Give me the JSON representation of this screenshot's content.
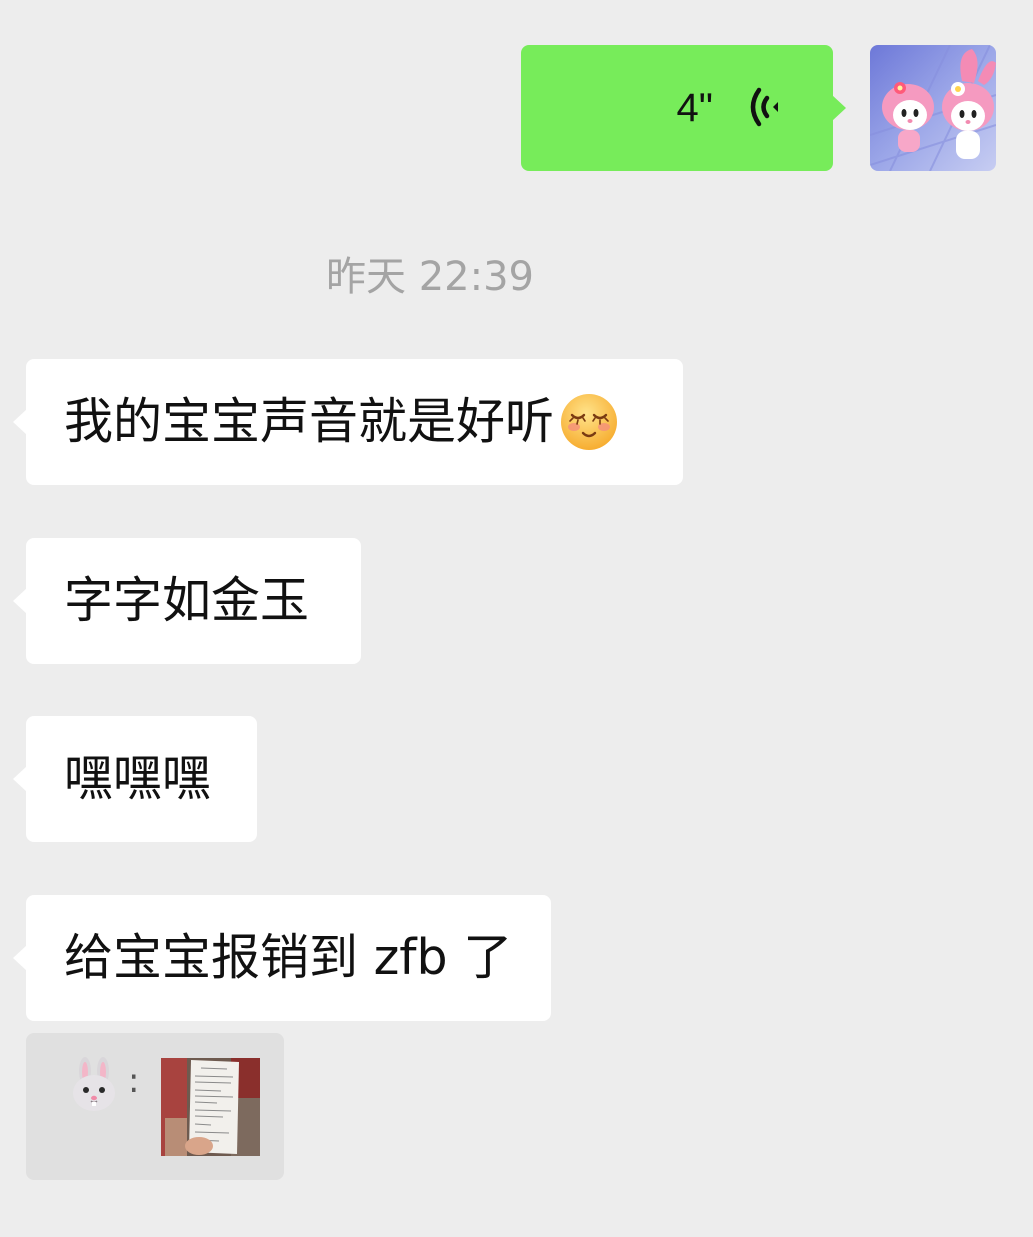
{
  "outgoing_voice": {
    "duration": "4\"",
    "icon": "voice-wave-icon",
    "bubble_color": "#77ec5a",
    "avatar_icon": "pink-bunny-avatar-icon"
  },
  "timestamp": "昨天 22:39",
  "incoming_messages": [
    {
      "text": "我的宝宝声音就是好听",
      "emoji": "blushing-smile-emoji-icon"
    },
    {
      "text": "字字如金玉"
    },
    {
      "text": "嘿嘿嘿"
    },
    {
      "text": "给宝宝报销到 zfb 了"
    }
  ],
  "quote": {
    "icon": "rabbit-icon",
    "separator": ":",
    "thumbnail": "receipt-photo-thumbnail"
  },
  "colors": {
    "background": "#ededed",
    "incoming_bubble": "#ffffff",
    "timestamp": "#a4a4a4",
    "quote_background": "#e0e0e0"
  }
}
